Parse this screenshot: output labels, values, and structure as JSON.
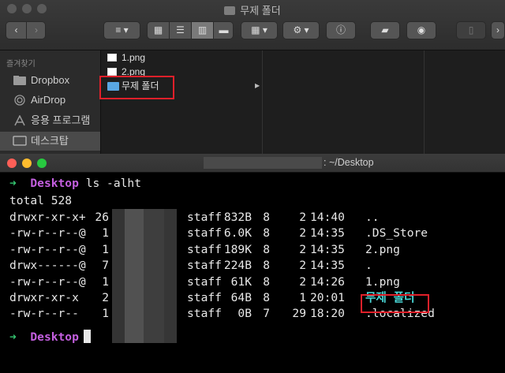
{
  "finder": {
    "window_title": "무제 폴더",
    "sidebar": {
      "heading": "즐겨찾기",
      "items": [
        {
          "label": "Dropbox",
          "icon": "folder-icon"
        },
        {
          "label": "AirDrop",
          "icon": "airdrop-icon"
        },
        {
          "label": "응용 프로그램",
          "icon": "applications-icon"
        },
        {
          "label": "데스크탑",
          "icon": "desktop-icon",
          "selected": true
        }
      ]
    },
    "files": [
      {
        "name": "1.png",
        "type": "image"
      },
      {
        "name": "2.png",
        "type": "image"
      },
      {
        "name": "무제 폴더",
        "type": "folder",
        "selected": true
      }
    ]
  },
  "terminal": {
    "title": ": ~/Desktop",
    "prompt_arrow": "➜",
    "prompt_dir": "Desktop",
    "command": "ls -alht",
    "total": "total 528",
    "rows": [
      {
        "perm": "drwxr-xr-x+",
        "links": "26",
        "group": "staff",
        "size": "832B",
        "month": "8",
        "day": "2",
        "time": "14:40",
        "name": ".."
      },
      {
        "perm": "-rw-r--r--@",
        "links": "1",
        "group": "staff",
        "size": "6.0K",
        "month": "8",
        "day": "2",
        "time": "14:35",
        "name": ".DS_Store"
      },
      {
        "perm": "-rw-r--r--@",
        "links": "1",
        "group": "staff",
        "size": "189K",
        "month": "8",
        "day": "2",
        "time": "14:35",
        "name": "2.png"
      },
      {
        "perm": "drwx------@",
        "links": "7",
        "group": "staff",
        "size": "224B",
        "month": "8",
        "day": "2",
        "time": "14:35",
        "name": "."
      },
      {
        "perm": "-rw-r--r--@",
        "links": "1",
        "group": "staff",
        "size": "61K",
        "month": "8",
        "day": "2",
        "time": "14:26",
        "name": "1.png"
      },
      {
        "perm": "drwxr-xr-x",
        "links": "2",
        "group": "staff",
        "size": "64B",
        "month": "8",
        "day": "1",
        "time": "20:01",
        "name": "무제 폴더",
        "highlight": true
      },
      {
        "perm": "-rw-r--r--",
        "links": "1",
        "group": "staff",
        "size": "0B",
        "month": "7",
        "day": "29",
        "time": "18:20",
        "name": ".localized"
      }
    ]
  },
  "colors": {
    "prompt_arrow": "#34c470",
    "prompt_dir": "#c45fe0",
    "dir_name": "#4ad9d9",
    "highlight_box": "#e0202a",
    "folder": "#59a7e3"
  }
}
